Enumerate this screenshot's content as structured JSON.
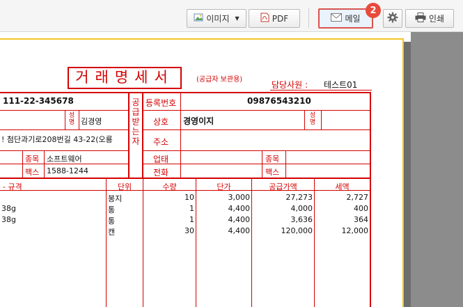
{
  "toolbar": {
    "image_label": "이미지",
    "pdf_label": "PDF",
    "mail_label": "메일",
    "print_label": "인쇄",
    "step_badge": "2"
  },
  "doc": {
    "title": "거래명세서",
    "subtitle": "(공급자 보관용)",
    "manager_label": "담당사원 :",
    "manager_value": "테스트01"
  },
  "supplier": {
    "regno": "111-22-345678",
    "name_label": "성명",
    "name": "김경영",
    "address": "! 첨단과기로208번길 43-22(오룡",
    "item_label": "종목",
    "item": "소프트웨어",
    "fax_label": "팩스",
    "fax": "1588-1244"
  },
  "receiver": {
    "vertical_label": "공급받는자",
    "regno_label": "등록번호",
    "regno": "09876543210",
    "company_label": "상호",
    "company": "경영이지",
    "name_label": "성명",
    "address_label": "주소",
    "business_label": "업태",
    "item_label": "종목",
    "phone_label": "전화",
    "fax_label": "팩스"
  },
  "table": {
    "headers": [
      "- 규격",
      "단위",
      "수량",
      "단가",
      "공급가액",
      "세액"
    ],
    "rows": [
      {
        "spec": "",
        "unit": "봉지",
        "qty": "10",
        "price": "3,000",
        "supply": "27,273",
        "tax": "2,727"
      },
      {
        "spec": "38g",
        "unit": "통",
        "qty": "1",
        "price": "4,400",
        "supply": "4,000",
        "tax": "400"
      },
      {
        "spec": "38g",
        "unit": "통",
        "qty": "1",
        "price": "4,400",
        "supply": "3,636",
        "tax": "364"
      },
      {
        "spec": "",
        "unit": "캔",
        "qty": "30",
        "price": "4,400",
        "supply": "120,000",
        "tax": "12,000"
      }
    ]
  },
  "colors": {
    "accent_red": "#d40000",
    "page_border": "#f3c623",
    "badge": "#e84a3c"
  }
}
